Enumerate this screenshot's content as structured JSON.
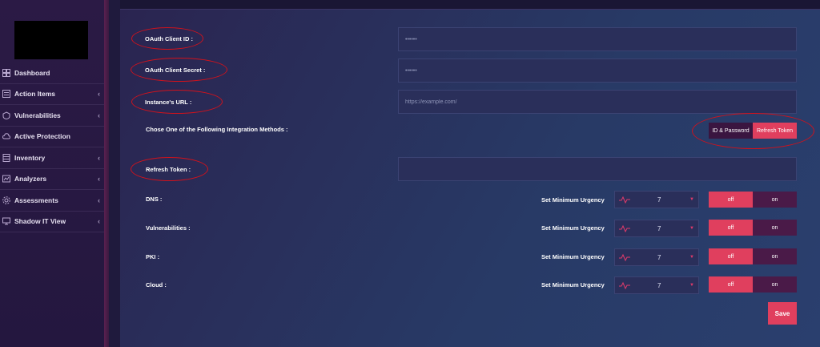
{
  "sidebar": {
    "items": [
      {
        "label": "Dashboard",
        "icon": "dashboard-icon",
        "has_chevron": false
      },
      {
        "label": "Action Items",
        "icon": "action-items-icon",
        "has_chevron": true
      },
      {
        "label": "Vulnerabilities",
        "icon": "vulnerabilities-icon",
        "has_chevron": true
      },
      {
        "label": "Active Protection",
        "icon": "cloud-icon",
        "has_chevron": false
      },
      {
        "label": "Inventory",
        "icon": "inventory-icon",
        "has_chevron": true
      },
      {
        "label": "Analyzers",
        "icon": "analyzers-icon",
        "has_chevron": true
      },
      {
        "label": "Assessments",
        "icon": "assessments-icon",
        "has_chevron": true
      },
      {
        "label": "Shadow IT View",
        "icon": "shadow-it-icon",
        "has_chevron": true
      }
    ]
  },
  "form": {
    "client_id": {
      "label": "OAuth Client ID :",
      "value": "••••••"
    },
    "client_secret": {
      "label": "OAuth Client Secret :",
      "value": "••••••"
    },
    "instance_url": {
      "label": "Instance's URL :",
      "placeholder": "https://example.com/"
    },
    "method": {
      "label": "Chose One of the Following Integration Methods :",
      "options": [
        "ID & Password",
        "Refresh Token"
      ],
      "selected": "Refresh Token"
    },
    "refresh_token": {
      "label": "Refresh Token :",
      "value": ""
    },
    "urgency_label": "Set Minimum Urgency",
    "off_label": "off",
    "on_label": "on",
    "rows": [
      {
        "label": "DNS :",
        "urgency": "7",
        "state": "off"
      },
      {
        "label": "Vulnerabilities :",
        "urgency": "7",
        "state": "off"
      },
      {
        "label": "PKI :",
        "urgency": "7",
        "state": "off"
      },
      {
        "label": "Cloud :",
        "urgency": "7",
        "state": "off"
      }
    ],
    "save_label": "Save"
  },
  "colors": {
    "accent": "#e03f5e",
    "annotation": "#d0121c",
    "toggle_inactive": "#4a1a48"
  }
}
